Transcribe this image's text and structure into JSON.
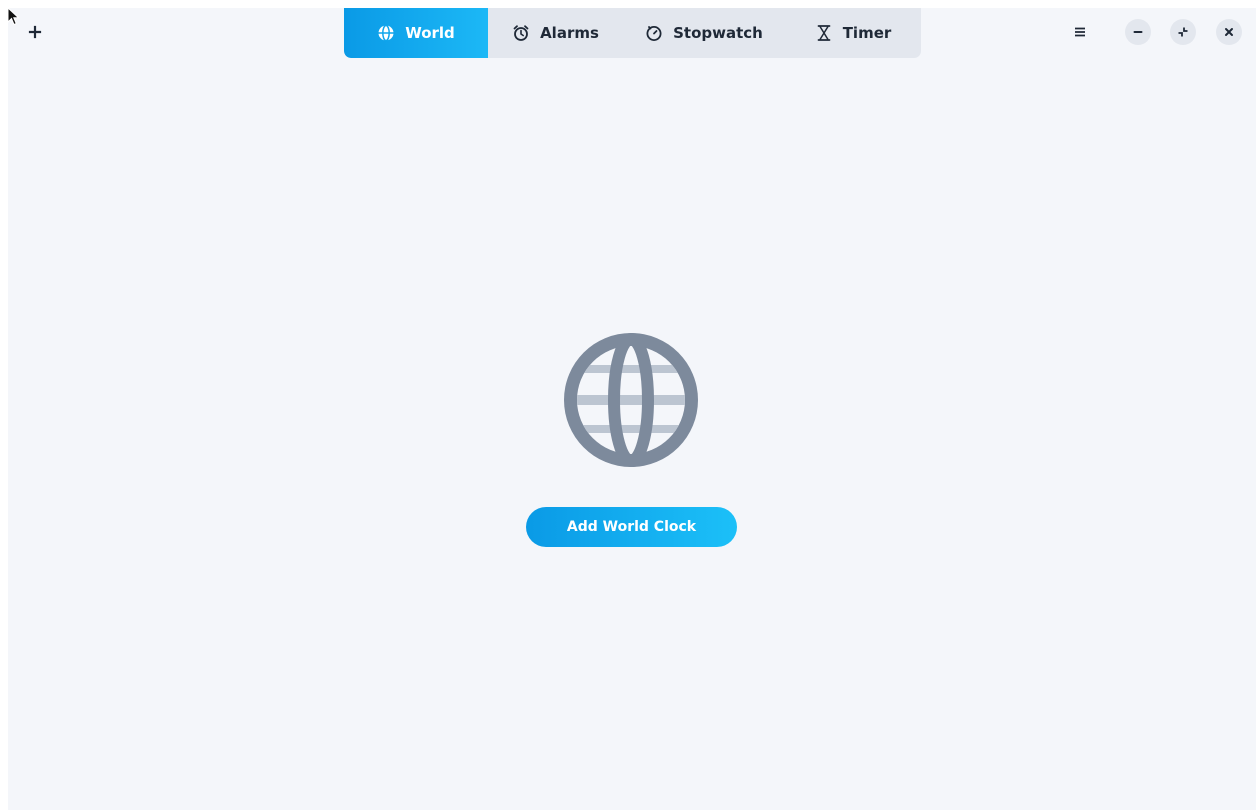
{
  "header": {
    "add_icon": "plus-icon",
    "tabs": [
      {
        "label": "World",
        "icon": "globe-icon",
        "active": true
      },
      {
        "label": "Alarms",
        "icon": "alarm-clock-icon",
        "active": false
      },
      {
        "label": "Stopwatch",
        "icon": "stopwatch-icon",
        "active": false
      },
      {
        "label": "Timer",
        "icon": "hourglass-icon",
        "active": false
      }
    ],
    "controls": [
      "menu-icon",
      "minimize-icon",
      "restore-icon",
      "close-icon"
    ]
  },
  "main": {
    "empty_icon": "globe-icon",
    "add_button_label": "Add World Clock"
  },
  "colors": {
    "accent_start": "#0a9ae6",
    "accent_end": "#1cc0f8",
    "background": "#f4f6fa",
    "tab_bar": "#e3e7ee",
    "globe": "#7d8a9c"
  }
}
